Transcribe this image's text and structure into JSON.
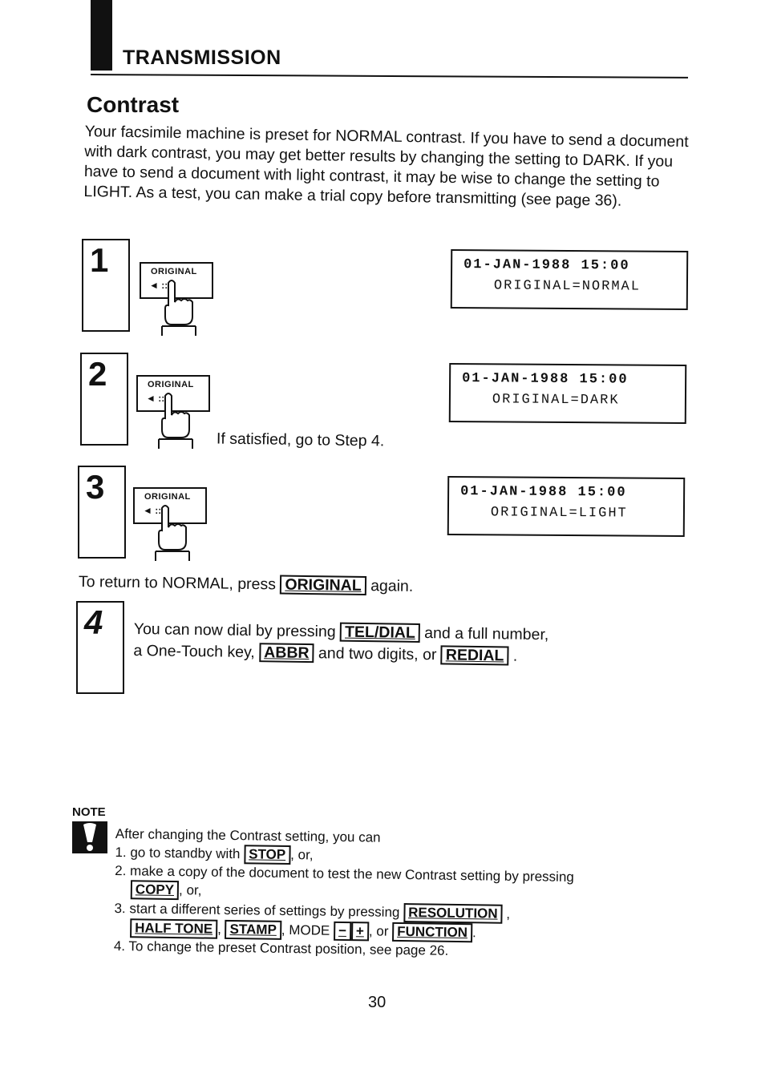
{
  "section": {
    "title": "TRANSMISSION"
  },
  "page": {
    "title": "Contrast",
    "number": "30"
  },
  "intro": "Your facsimile machine is preset for NORMAL contrast. If you have to send a document with dark contrast, you may get better results by changing the setting to DARK. If you have to send a document with light contrast, it may be wise to change the setting to LIGHT. As a test, you can make a trial copy before transmitting (see page 36).",
  "steps": [
    {
      "number": "1",
      "key_label": "ORIGINAL",
      "key_arrow": "◄ ::::",
      "lcd_line1": "01-JAN-1988 15:00",
      "lcd_line2": "ORIGINAL=NORMAL"
    },
    {
      "number": "2",
      "key_label": "ORIGINAL",
      "key_arrow": "◄ ::::",
      "lcd_line1": "01-JAN-1988 15:00",
      "lcd_line2": "ORIGINAL=DARK",
      "caption": "If satisfied, go to Step 4."
    },
    {
      "number": "3",
      "key_label": "ORIGINAL",
      "key_arrow": "◄ ::::",
      "lcd_line1": "01-JAN-1988 15:00",
      "lcd_line2": "ORIGINAL=LIGHT"
    },
    {
      "number": "4"
    }
  ],
  "return_note": {
    "before": "To return to NORMAL, press",
    "key": "ORIGINAL",
    "after": "again."
  },
  "step4_text": {
    "l1_before": "You can now dial by pressing",
    "key_tel": "TEL/DIAL",
    "l1_after": "and a full number,",
    "l2_before": "a One-Touch key,",
    "key_abbr": "ABBR",
    "l2_mid": "and two digits, or",
    "key_redial": "REDIAL",
    "l2_after": "."
  },
  "note": {
    "label": "NOTE",
    "intro": "After changing the Contrast setting, you can",
    "item1_before": "1. go to standby with",
    "item1_key": "STOP",
    "item1_after": ", or,",
    "item2_line1": "2. make a copy of the document to test the new Contrast setting by pressing",
    "item2_key": "COPY",
    "item2_after": ", or,",
    "item3_line1": "3. start a different series of settings by pressing",
    "item3_key_resolution": "RESOLUTION",
    "item3_comma": ",",
    "item3_key_halftone": "HALF TONE",
    "item3_key_stamp": "STAMP",
    "item3_mode": ", MODE",
    "item3_key_minus": "−",
    "item3_key_plus": "+",
    "item3_or": ", or",
    "item3_key_function": "FUNCTION",
    "item3_end": ".",
    "item4": "4. To change the preset Contrast position, see page 26."
  }
}
